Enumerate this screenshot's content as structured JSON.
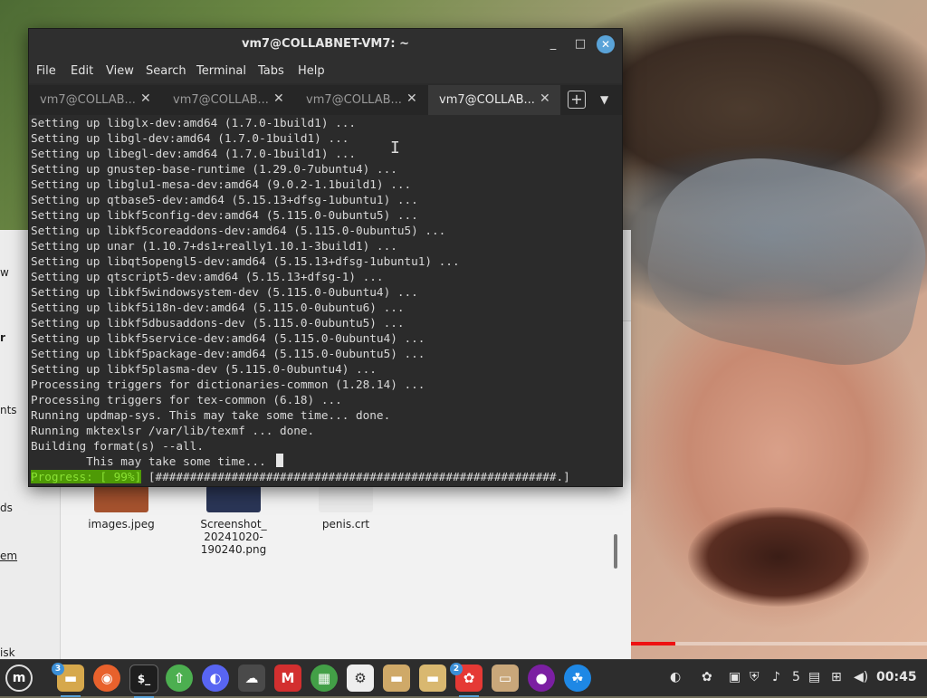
{
  "window": {
    "title": "vm7@COLLABNET-VM7: ~",
    "minimize": "_",
    "maximize": "□",
    "close": "✕"
  },
  "menu": [
    "File",
    "Edit",
    "View",
    "Search",
    "Terminal",
    "Tabs",
    "Help"
  ],
  "tabs": [
    {
      "label": "vm7@COLLAB...",
      "close": "✕"
    },
    {
      "label": "vm7@COLLAB...",
      "close": "✕"
    },
    {
      "label": "vm7@COLLAB...",
      "close": "✕"
    },
    {
      "label": "vm7@COLLAB...",
      "close": "✕"
    }
  ],
  "tab_actions": {
    "new_tab": "+",
    "menu": "▼"
  },
  "terminal_lines": [
    "Setting up libglx-dev:amd64 (1.7.0-1build1) ...",
    "Setting up libgl-dev:amd64 (1.7.0-1build1) ...",
    "Setting up libegl-dev:amd64 (1.7.0-1build1) ...",
    "Setting up gnustep-base-runtime (1.29.0-7ubuntu4) ...",
    "Setting up libglu1-mesa-dev:amd64 (9.0.2-1.1build1) ...",
    "Setting up qtbase5-dev:amd64 (5.15.13+dfsg-1ubuntu1) ...",
    "Setting up libkf5config-dev:amd64 (5.115.0-0ubuntu5) ...",
    "Setting up libkf5coreaddons-dev:amd64 (5.115.0-0ubuntu5) ...",
    "Setting up unar (1.10.7+ds1+really1.10.1-3build1) ...",
    "Setting up libqt5opengl5-dev:amd64 (5.15.13+dfsg-1ubuntu1) ...",
    "Setting up qtscript5-dev:amd64 (5.15.13+dfsg-1) ...",
    "Setting up libkf5windowsystem-dev (5.115.0-0ubuntu4) ...",
    "Setting up libkf5i18n-dev:amd64 (5.115.0-0ubuntu6) ...",
    "Setting up libkf5dbusaddons-dev (5.115.0-0ubuntu5) ...",
    "Setting up libkf5service-dev:amd64 (5.115.0-0ubuntu4) ...",
    "Setting up libkf5package-dev:amd64 (5.115.0-0ubuntu5) ...",
    "Setting up libkf5plasma-dev (5.115.0-0ubuntu4) ...",
    "Processing triggers for dictionaries-common (1.28.14) ...",
    "Processing triggers for tex-common (6.18) ...",
    "Running updmap-sys. This may take some time... done.",
    "Running mktexlsr /var/lib/texmf ... done.",
    "Building format(s) --all.",
    "        This may take some time... "
  ],
  "progress": {
    "label": "Progress: [ 99%]",
    "bar": "[##########################################################.]",
    "percent": 99
  },
  "file_manager": {
    "sidebar_labels": [
      "w",
      "r",
      "nts",
      "ds",
      "em",
      "isk"
    ],
    "files": [
      {
        "name": "images.jpeg"
      },
      {
        "name": "Screenshot_\n20241020-\n190240.png"
      },
      {
        "name": "penis.crt"
      }
    ]
  },
  "taskbar": {
    "apps": [
      {
        "name": "menu",
        "glyph": "m",
        "color": "#3a3a3a"
      },
      {
        "name": "files",
        "glyph": "▬",
        "color": "#d6a84c",
        "badge": "3"
      },
      {
        "name": "firefox",
        "glyph": "◉",
        "color": "#e8612c"
      },
      {
        "name": "terminal",
        "glyph": "$_",
        "color": "#1e1e1e"
      },
      {
        "name": "update-manager",
        "glyph": "⇧",
        "color": "#4caf50"
      },
      {
        "name": "discord",
        "glyph": "◐",
        "color": "#5865f2"
      },
      {
        "name": "cloud",
        "glyph": "☁",
        "color": "#4a4a4a"
      },
      {
        "name": "game",
        "glyph": "M",
        "color": "#d32f2f"
      },
      {
        "name": "grid-app",
        "glyph": "▦",
        "color": "#43a047"
      },
      {
        "name": "settings",
        "glyph": "⚙",
        "color": "#eeeeee"
      },
      {
        "name": "folder",
        "glyph": "▬",
        "color": "#cfa968"
      },
      {
        "name": "folder-2",
        "glyph": "▬",
        "color": "#d9b870"
      },
      {
        "name": "bee-app",
        "glyph": "✿",
        "color": "#e53935",
        "badge": "2"
      },
      {
        "name": "archive",
        "glyph": "▭",
        "color": "#c9a77a"
      },
      {
        "name": "purple-app",
        "glyph": "●",
        "color": "#7b1fa2"
      },
      {
        "name": "web-app",
        "glyph": "☘",
        "color": "#1e88e5"
      }
    ],
    "tray": {
      "notification_count": "5",
      "clock": "00:45"
    }
  }
}
